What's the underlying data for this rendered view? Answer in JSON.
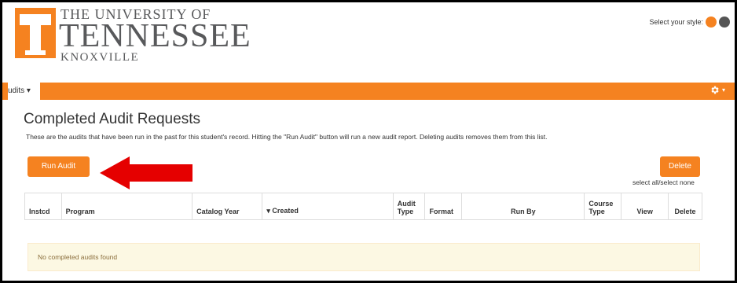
{
  "header": {
    "logo_letter": "T",
    "university_line1": "THE UNIVERSITY OF",
    "university_line2": "TENNESSEE",
    "university_line3": "KNOXVILLE",
    "style_label": "Select your style:",
    "style_options": [
      {
        "name": "orange",
        "color": "#f58220"
      },
      {
        "name": "gray",
        "color": "#555555"
      }
    ]
  },
  "navbar": {
    "menu_label": "udits",
    "caret": "▾",
    "gear_icon": "gear-icon",
    "color": "#f58220"
  },
  "main": {
    "title": "Completed Audit Requests",
    "description": "These are the audits that have been run in the past for this student's record. Hitting the \"Run Audit\" button will run a new audit report. Deleting audits removes them from this list.",
    "run_button": "Run Audit",
    "delete_button": "Delete",
    "select_all": "select all/select none",
    "table": {
      "columns": [
        "Instcd",
        "Program",
        "Catalog Year",
        "▾ Created",
        "Audit Type",
        "Format",
        "Run By",
        "Course Type",
        "View",
        "Delete"
      ],
      "empty_message": "No completed audits found"
    }
  },
  "annotation": {
    "arrow_color": "#e50000",
    "arrow_icon": "left-arrow-icon"
  }
}
